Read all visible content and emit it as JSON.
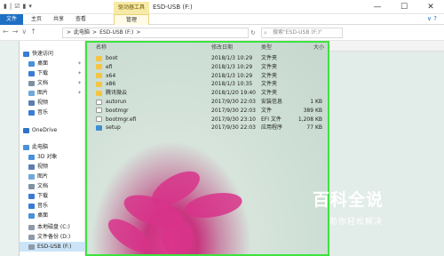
{
  "window": {
    "title": "ESD-USB (F:)",
    "tool_tab": "驱动器工具",
    "controls": [
      "—",
      "☐",
      "✕"
    ]
  },
  "ribbon": {
    "tabs": {
      "file": "文件",
      "home": "主页",
      "share": "共享",
      "view": "查看",
      "manage": "管理"
    },
    "help": "∨ ?"
  },
  "address": {
    "path": [
      ">",
      "此电脑",
      ">",
      "ESD-USB (F:)",
      ">"
    ],
    "search_placeholder": "搜索\"ESD-USB (F:)\""
  },
  "navpane": {
    "items": [
      {
        "label": "快速访问",
        "icon": "star-icon",
        "color": "#3a7bd5",
        "pinned": false
      },
      {
        "label": "桌面",
        "icon": "desktop-icon",
        "color": "#4a90d9",
        "pinned": true
      },
      {
        "label": "下载",
        "icon": "download-icon",
        "color": "#3a7bd5",
        "pinned": true
      },
      {
        "label": "文档",
        "icon": "document-icon",
        "color": "#7f8fa6",
        "pinned": true
      },
      {
        "label": "图片",
        "icon": "picture-icon",
        "color": "#6fa8dc",
        "pinned": true
      },
      {
        "label": "视频",
        "icon": "video-icon",
        "color": "#5b7db1",
        "pinned": false
      },
      {
        "label": "音乐",
        "icon": "music-icon",
        "color": "#3a7bd5",
        "pinned": false
      },
      {
        "label": "OneDrive",
        "icon": "cloud-icon",
        "color": "#2f73c9",
        "pinned": false
      },
      {
        "label": "此电脑",
        "icon": "computer-icon",
        "color": "#4a90d9",
        "pinned": false
      },
      {
        "label": "3D 对象",
        "icon": "cube-icon",
        "color": "#4a90d9",
        "pinned": false
      },
      {
        "label": "视频",
        "icon": "video-icon",
        "color": "#5b7db1",
        "pinned": false
      },
      {
        "label": "图片",
        "icon": "picture-icon",
        "color": "#6fa8dc",
        "pinned": false
      },
      {
        "label": "文档",
        "icon": "document-icon",
        "color": "#7f8fa6",
        "pinned": false
      },
      {
        "label": "下载",
        "icon": "download-icon",
        "color": "#3a7bd5",
        "pinned": false
      },
      {
        "label": "音乐",
        "icon": "music-icon",
        "color": "#3a7bd5",
        "pinned": false
      },
      {
        "label": "桌面",
        "icon": "desktop-icon",
        "color": "#4a90d9",
        "pinned": false
      },
      {
        "label": "本地磁盘 (C:)",
        "icon": "drive-icon",
        "color": "#8e9aa8",
        "pinned": false
      },
      {
        "label": "文件备份 (D:)",
        "icon": "drive-icon",
        "color": "#8e9aa8",
        "pinned": false
      },
      {
        "label": "ESD-USB (F:)",
        "icon": "usb-drive-icon",
        "color": "#8e9aa8",
        "pinned": false
      }
    ]
  },
  "filelist": {
    "columns": {
      "name": "名称",
      "date": "修改日期",
      "type": "类型",
      "size": "大小"
    },
    "rows": [
      {
        "name": "boot",
        "date": "2018/1/3 10:29",
        "type": "文件夹",
        "size": "",
        "kind": "folder"
      },
      {
        "name": "efi",
        "date": "2018/1/3 10:29",
        "type": "文件夹",
        "size": "",
        "kind": "folder"
      },
      {
        "name": "x64",
        "date": "2018/1/3 10:29",
        "type": "文件夹",
        "size": "",
        "kind": "folder"
      },
      {
        "name": "x86",
        "date": "2018/1/3 10:35",
        "type": "文件夹",
        "size": "",
        "kind": "folder"
      },
      {
        "name": "腾讯微云",
        "date": "2018/1/20 19:40",
        "type": "文件夹",
        "size": "",
        "kind": "folder"
      },
      {
        "name": "autorun",
        "date": "2017/9/30 22:03",
        "type": "安装信息",
        "size": "1 KB",
        "kind": "file"
      },
      {
        "name": "bootmgr",
        "date": "2017/9/30 22:03",
        "type": "文件",
        "size": "389 KB",
        "kind": "file"
      },
      {
        "name": "bootmgr.efi",
        "date": "2017/9/30 23:10",
        "type": "EFI 文件",
        "size": "1,208 KB",
        "kind": "file"
      },
      {
        "name": "setup",
        "date": "2017/9/30 22:03",
        "type": "应用程序",
        "size": "77 KB",
        "kind": "setup"
      }
    ]
  },
  "watermark": {
    "title": "百科全说",
    "subtitle": "助你轻松解决"
  }
}
